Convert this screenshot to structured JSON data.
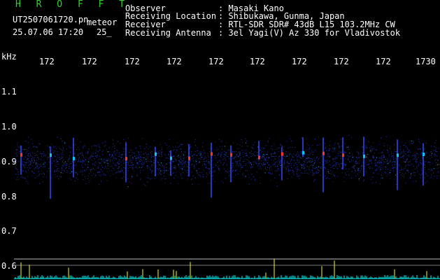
{
  "header": {
    "title": "H R O F F T",
    "filename": "UT2507061720.pn",
    "suffix": "meteor",
    "datetime": "25.07.06 17:20",
    "extra": "25_",
    "fields": [
      {
        "label": "Observer",
        "value": ": Masaki Kano"
      },
      {
        "label": "Receiving Location",
        "value": ": Shibukawa, Gunma, Japan"
      },
      {
        "label": "Receiver",
        "value": ": RTL-SDR SDR# 43dB L15 103.2MHz CW"
      },
      {
        "label": "Receiving Antenna",
        "value": ": 3el Yagi(V) Az 330 for Vladivostok"
      }
    ]
  },
  "axis": {
    "unit": "kHz",
    "time_ticks": [
      "172",
      "172",
      "172",
      "172",
      "172",
      "172",
      "172",
      "172",
      "172",
      "1730"
    ],
    "freq_ticks": [
      "1.1",
      "1.0",
      "0.9",
      "0.8",
      "0.7",
      "0.6"
    ]
  },
  "colors": {
    "background": "#000000",
    "title": "#2bd62b",
    "signal_low": "#1e2aa8",
    "signal_mid": "#00c8ff",
    "signal_high": "#ff3030",
    "activity_line": "#ffff00",
    "baseline": "#00ffff"
  }
}
